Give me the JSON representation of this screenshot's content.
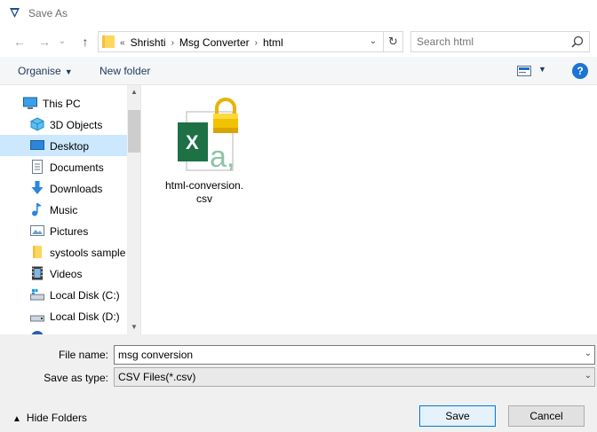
{
  "window": {
    "title": "Save As"
  },
  "address": {
    "chevron": "«",
    "crumbs": [
      "Shrishti",
      "Msg Converter",
      "html"
    ]
  },
  "search": {
    "placeholder": "Search html"
  },
  "toolbar": {
    "organise_label": "Organise",
    "new_folder_label": "New folder",
    "help_label": "?"
  },
  "sidebar": {
    "items": [
      {
        "label": "This PC",
        "icon": "computer-icon"
      },
      {
        "label": "3D Objects",
        "icon": "cube-icon"
      },
      {
        "label": "Desktop",
        "icon": "desktop-icon",
        "selected": true
      },
      {
        "label": "Documents",
        "icon": "document-icon"
      },
      {
        "label": "Downloads",
        "icon": "download-icon"
      },
      {
        "label": "Music",
        "icon": "music-icon"
      },
      {
        "label": "Pictures",
        "icon": "pictures-icon"
      },
      {
        "label": "systools sample",
        "icon": "folder-icon"
      },
      {
        "label": "Videos",
        "icon": "video-icon"
      },
      {
        "label": "Local Disk (C:)",
        "icon": "disk-icon"
      },
      {
        "label": "Local Disk (D:)",
        "icon": "disk-icon"
      }
    ]
  },
  "files": [
    {
      "name": "html-conversion.csv",
      "name_line1": "html-conversion.",
      "name_line2": "csv",
      "icon": "excel-csv-locked-icon"
    }
  ],
  "form": {
    "file_name_label": "File name:",
    "file_name_value": "msg conversion",
    "save_type_label": "Save as type:",
    "save_type_value": "CSV Files(*.csv)"
  },
  "footer": {
    "hide_folders_label": "Hide Folders",
    "save_label": "Save",
    "cancel_label": "Cancel"
  },
  "colors": {
    "accent": "#0078d7",
    "selection": "#cce8ff",
    "excel_green": "#1e7145",
    "lock_gold": "#e8b400"
  }
}
